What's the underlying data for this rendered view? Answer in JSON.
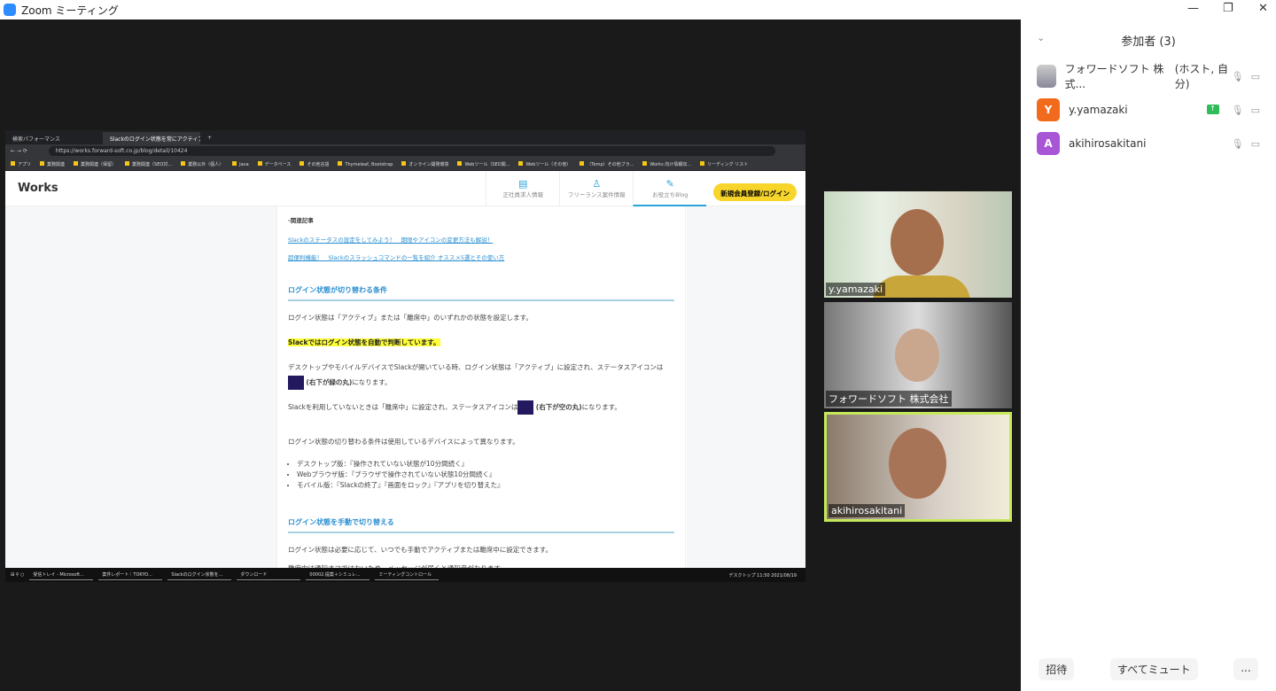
{
  "window": {
    "title": "Zoom ミーティング"
  },
  "browser": {
    "tabs": [
      "検索パフォーマンス",
      "Slackのログイン状態を常にアクティブ"
    ],
    "url": "https://works.forward-soft.co.jp/blog/detail/10424",
    "bookmarks": [
      "アプリ",
      "業務関連",
      "業務関連（保留）",
      "業務関連（SEO対...",
      "業務以外（個人）",
      "Java",
      "データベース",
      "その他言語",
      "Thymeleaf, Bootstrap",
      "オンライン開発環境",
      "Webツール（SEO関...",
      "Webツール（その他）",
      "（Temp）その他ブラ...",
      "Works 向け情報収...",
      "リーディング リスト"
    ]
  },
  "site": {
    "brand": "Works",
    "nav": [
      {
        "icon": "document-icon",
        "label": "正社員求人情報"
      },
      {
        "icon": "person-icon",
        "label": "フリーランス案件情報"
      },
      {
        "icon": "edit-icon",
        "label": "お役立ちBlog"
      }
    ],
    "cta": "新規会員登録/ログイン"
  },
  "article": {
    "related_title": "-関連記事",
    "links": [
      "Slackのステータスの設定をしてみよう！　期限やアイコンの変更方法も解説！",
      "超便利機能！　Slackのスラッシュコマンドの一覧を紹介 オススメ5選とその使い方"
    ],
    "h1": "ログイン状態が切り替わる条件",
    "p1": "ログイン状態は「アクティブ」または「離席中」のいずれかの状態を設定します。",
    "highlight": "Slackではログイン状態を自動で判断しています。",
    "p2a": "デスクトップやモバイルデバイスでSlackが開いている時、ログイン状態は「アクティブ」に設定され、ステータスアイコンは",
    "p2b": "(右下が緑の丸)",
    "p2c": "になります。",
    "p3a": "Slackを利用していないときは「離席中」に設定され、ステータスアイコンは",
    "p3b": "(右下が空の丸)",
    "p3c": "になります。",
    "p4": "ログイン状態の切り替わる条件は使用しているデバイスによって異なります。",
    "bullets": [
      "デスクトップ版：『操作されていない状態が10分間続く』",
      "Webブラウザ版：『ブラウザで操作されていない状態10分間続く』",
      "モバイル版：『Slackの終了』『画面をロック』『アプリを切り替えた』"
    ],
    "h2": "ログイン状態を手動で切り替える",
    "p5": "ログイン状態は必要に応じて、いつでも手動でアクティブまたは離席中に設定できます。",
    "p6": "離席中は通知オフではないため、メッセージが届くと通知音がなります。"
  },
  "taskbar": {
    "items": [
      "受信トレイ - Microsoft...",
      "案件レポート｜TOKYO...",
      "Slackのログイン状態を...",
      "ダウンロード",
      "00002.提案＋シミュレ...",
      "ミーティングコントロール"
    ],
    "desktop": "デスクトップ",
    "time": "11:50",
    "date": "2021/08/19"
  },
  "videos": [
    {
      "name": "y.yamazaki"
    },
    {
      "name": "フォワードソフト 株式会社"
    },
    {
      "name": "akihirosakitani"
    }
  ],
  "participants": {
    "title": "参加者 (3)",
    "list": [
      {
        "name": "フォワードソフト 株式...",
        "role": "(ホスト, 自分)",
        "initial": "",
        "color": "#9aa"
      },
      {
        "name": "y.yamazaki",
        "role": "",
        "initial": "Y",
        "color": "#f26b1d"
      },
      {
        "name": "akihirosakitani",
        "role": "",
        "initial": "A",
        "color": "#a855d6"
      }
    ],
    "footer": {
      "invite": "招待",
      "mute_all": "すべてミュート",
      "more": "..."
    }
  }
}
